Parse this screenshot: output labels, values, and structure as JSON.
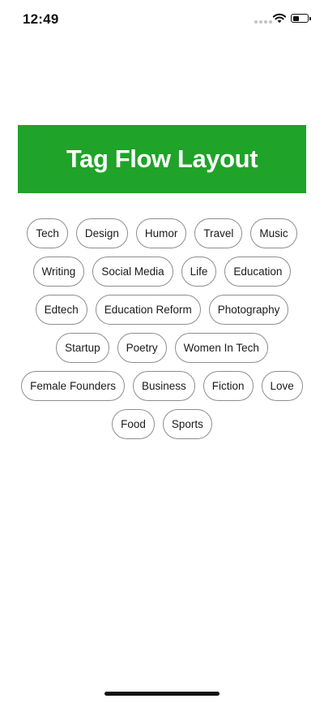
{
  "status_bar": {
    "time": "12:49",
    "icons": [
      "cellular-signal-icon",
      "wifi-icon",
      "battery-icon"
    ]
  },
  "header": {
    "title": "Tag Flow Layout",
    "color": "#1fa329"
  },
  "tag_rows": [
    [
      "Tech",
      "Design",
      "Humor",
      "Travel",
      "Music"
    ],
    [
      "Writing",
      "Social Media",
      "Life",
      "Education"
    ],
    [
      "Edtech",
      "Education Reform",
      "Photography"
    ],
    [
      "Startup",
      "Poetry",
      "Women In Tech"
    ],
    [
      "Female Founders",
      "Business",
      "Fiction",
      "Love"
    ],
    [
      "Food",
      "Sports"
    ]
  ]
}
